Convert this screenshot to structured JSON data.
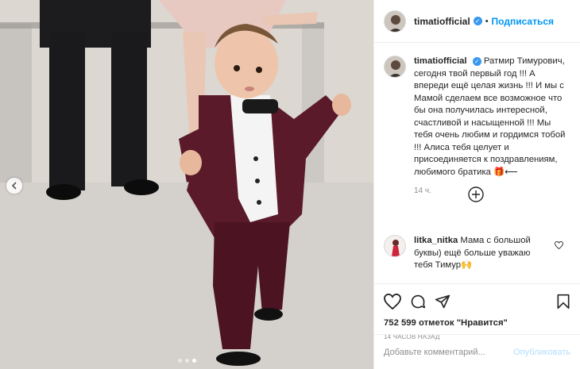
{
  "post": {
    "author": "timatiofficial",
    "follow_label": "Подписаться",
    "separator": "•",
    "verified_icon": "check-icon"
  },
  "caption": {
    "author": "timatiofficial",
    "text": "Ратмир Тимурович, сегодня твой первый год !!! А впереди ещё целая жизнь !!! И мы с Мамой сделаем все возможное что бы она получилась интересной, счастливой и насыщенной !!! Мы тебя очень любим и гордимся тобой !!! Алиса тебя целует и присоединяется к поздравлениям, любимого братика 🎁⟵",
    "age": "14 ч."
  },
  "comment": {
    "author": "litka_nitka",
    "text": "Мама с большой буквы) ещё больше уважаю тебя Тимур🙌"
  },
  "stats": {
    "likes": "752 599 отметок \"Нравится\"",
    "time": "14 ЧАСОВ НАЗАД"
  },
  "composer": {
    "placeholder": "Добавьте комментарий...",
    "publish_label": "Опубликовать"
  },
  "carousel": {
    "slides": 3,
    "active": 2
  },
  "colors": {
    "accent": "#0095f6",
    "verified": "#3897f0",
    "muted": "#8e8e8e",
    "suit": "#5a1a2a"
  }
}
